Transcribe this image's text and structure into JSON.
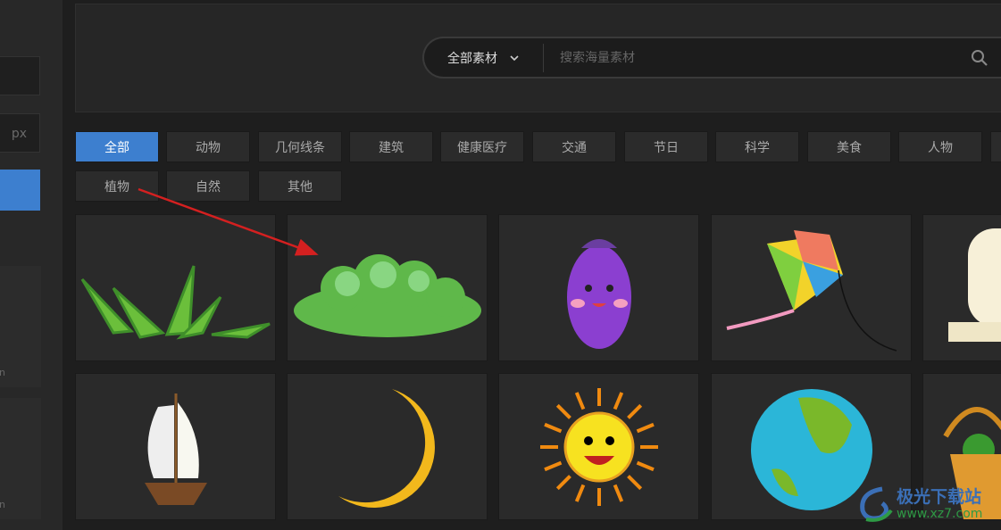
{
  "left_panel": {
    "unit": "px",
    "card_labels": [
      "n",
      "n"
    ]
  },
  "search": {
    "category": "全部素材",
    "placeholder": "搜索海量素材",
    "icons": {
      "dropdown": "chevron-down-icon",
      "search": "search-icon"
    }
  },
  "tags": [
    {
      "label": "全部",
      "active": true
    },
    {
      "label": "动物"
    },
    {
      "label": "几何线条"
    },
    {
      "label": "建筑"
    },
    {
      "label": "健康医疗"
    },
    {
      "label": "交通"
    },
    {
      "label": "节日"
    },
    {
      "label": "科学"
    },
    {
      "label": "美食"
    },
    {
      "label": "人物"
    },
    {
      "label": ""
    },
    {
      "label": "植物"
    },
    {
      "label": "自然"
    },
    {
      "label": "其他"
    }
  ],
  "assets": [
    "grass",
    "bush",
    "eggplant",
    "kite",
    "chef-hat",
    "sailboat",
    "moon",
    "sun",
    "earth",
    "basket"
  ],
  "watermark": {
    "name": "极光下载站",
    "url": "www.xz7.com"
  },
  "colors": {
    "accent": "#3d7fcf",
    "annotation_arrow": "#d42020"
  }
}
